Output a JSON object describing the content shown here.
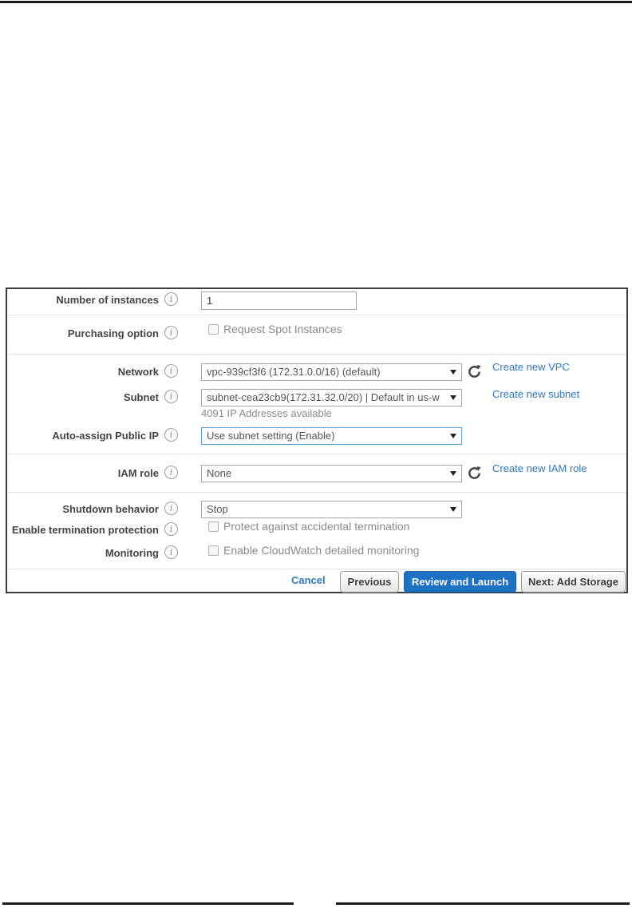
{
  "panel": {
    "fields": {
      "number_of_instances": {
        "label": "Number of instances",
        "value": "1"
      },
      "purchasing_option": {
        "label": "Purchasing option",
        "checkbox_label": "Request Spot Instances",
        "checked": false
      },
      "network": {
        "label": "Network",
        "selected": "vpc-939cf3f6 (172.31.0.0/16) (default)",
        "link": "Create new VPC"
      },
      "subnet": {
        "label": "Subnet",
        "selected": "subnet-cea23cb9(172.31.32.0/20) | Default in us-w",
        "link": "Create new subnet",
        "note": "4091 IP Addresses available"
      },
      "auto_assign_public_ip": {
        "label": "Auto-assign Public IP",
        "selected": "Use subnet setting (Enable)"
      },
      "iam_role": {
        "label": "IAM role",
        "selected": "None",
        "link": "Create new IAM role"
      },
      "shutdown_behavior": {
        "label": "Shutdown behavior",
        "selected": "Stop"
      },
      "termination_protection": {
        "label": "Enable termination protection",
        "checkbox_label": "Protect against accidental termination",
        "checked": false
      },
      "monitoring": {
        "label": "Monitoring",
        "checkbox_label": "Enable CloudWatch detailed monitoring",
        "checked": false
      }
    },
    "info_icon_glyph": "i",
    "footer": {
      "cancel": "Cancel",
      "previous": "Previous",
      "review_and_launch": "Review and Launch",
      "next_add_storage": "Next: Add Storage"
    },
    "colors": {
      "link_blue": "#2e77bb",
      "primary_button_blue": "#1e72c4",
      "label_dark": "#444444",
      "muted_gray": "#8a8a8a"
    }
  }
}
